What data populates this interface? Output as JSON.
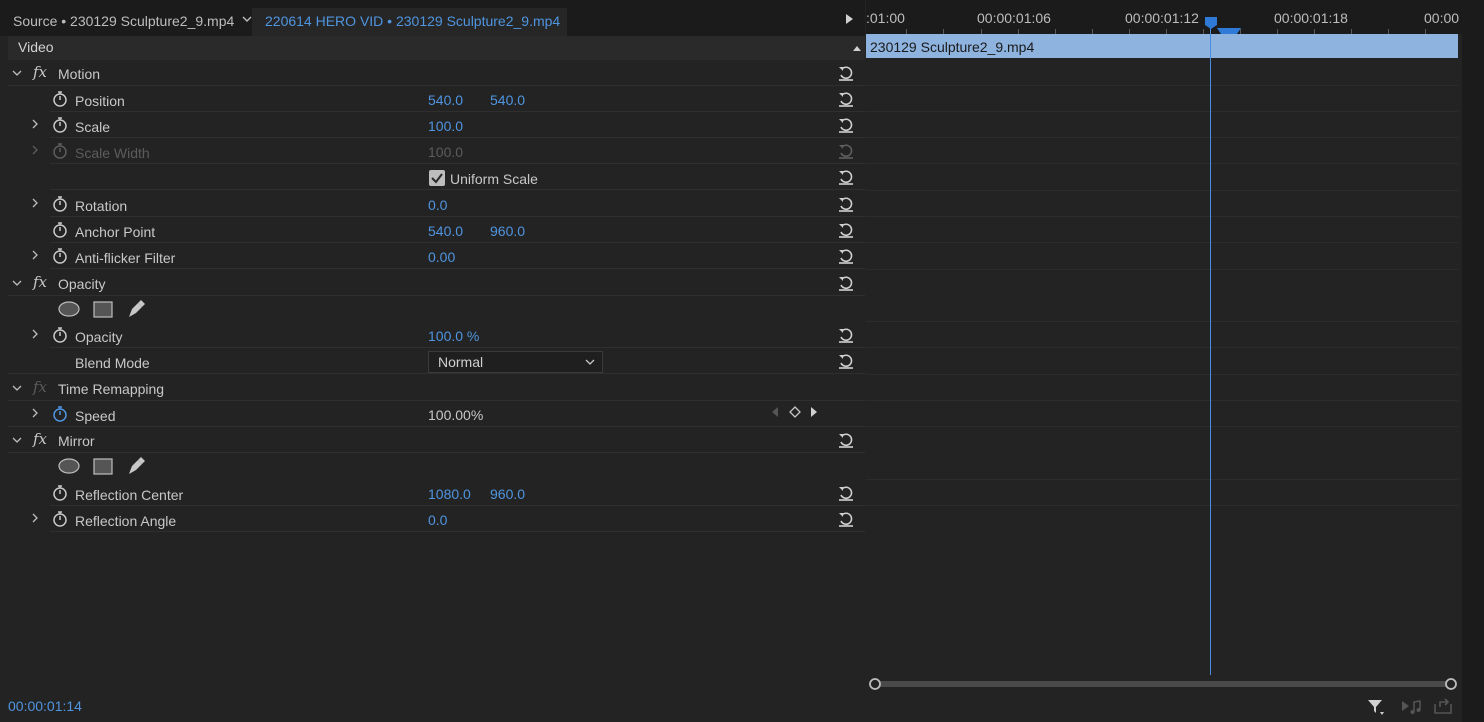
{
  "tabs": {
    "source": "Source • 230129 Sculpture2_9.mp4",
    "sequence": "220614 HERO VID • 230129 Sculpture2_9.mp4"
  },
  "panel": {
    "section_title": "Video",
    "timecode": "00:00:01:14"
  },
  "motion": {
    "title": "Motion",
    "position": {
      "label": "Position",
      "x": "540.0",
      "y": "540.0"
    },
    "scale": {
      "label": "Scale",
      "value": "100.0"
    },
    "scale_width": {
      "label": "Scale Width",
      "value": "100.0"
    },
    "uniform_scale": {
      "label": "Uniform Scale",
      "checked": true
    },
    "rotation": {
      "label": "Rotation",
      "value": "0.0"
    },
    "anchor_point": {
      "label": "Anchor Point",
      "x": "540.0",
      "y": "960.0"
    },
    "anti_flicker": {
      "label": "Anti-flicker Filter",
      "value": "0.00"
    }
  },
  "opacity": {
    "title": "Opacity",
    "opacity": {
      "label": "Opacity",
      "value": "100.0 %"
    },
    "blend_mode": {
      "label": "Blend Mode",
      "value": "Normal"
    }
  },
  "time_remapping": {
    "title": "Time Remapping",
    "speed": {
      "label": "Speed",
      "value": "100.00%"
    }
  },
  "mirror": {
    "title": "Mirror",
    "reflection_center": {
      "label": "Reflection Center",
      "x": "1080.0",
      "y": "960.0"
    },
    "reflection_angle": {
      "label": "Reflection Angle",
      "value": "0.0"
    }
  },
  "timeline": {
    "ruler_labels": [
      ":01:00",
      "00:00:01:06",
      "00:00:01:12",
      "00:00:01:18",
      "00:00"
    ],
    "clip_name": "230129 Sculpture2_9.mp4"
  },
  "colors": {
    "accent": "#4f95e0",
    "clip": "#8eb3df",
    "panel": "#232323"
  }
}
